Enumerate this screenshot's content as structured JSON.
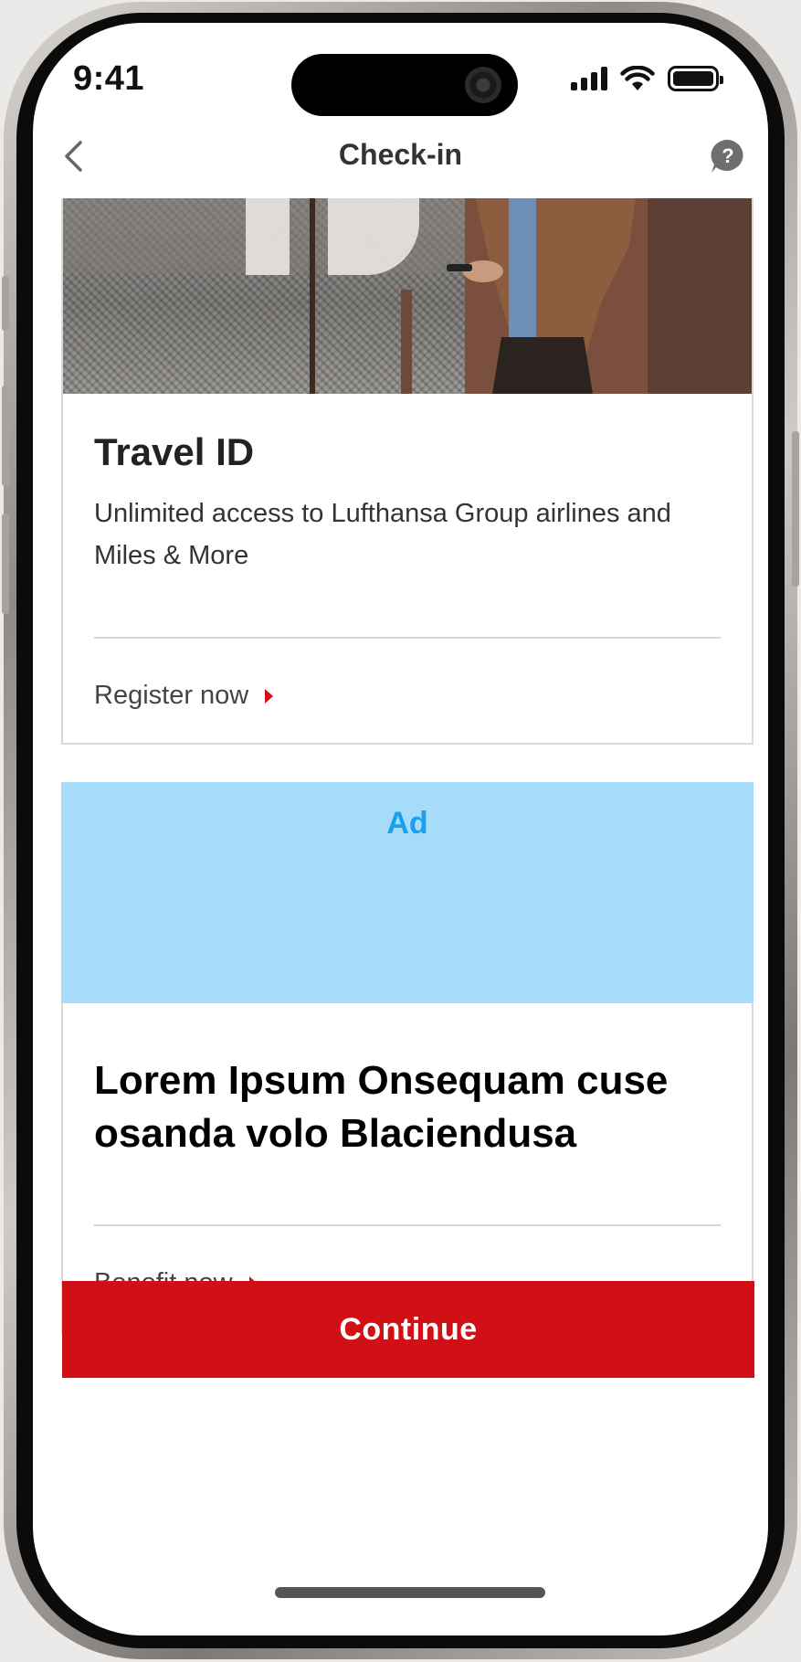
{
  "status_bar": {
    "time": "9:41"
  },
  "nav": {
    "title": "Check-in",
    "back_icon": "chevron-left-icon",
    "help_icon": "question-bubble-icon",
    "help_glyph": "?"
  },
  "hero_image": {
    "lettering": "ID"
  },
  "travel_card": {
    "title": "Travel ID",
    "description": "Unlimited access to Lufthansa Group airlines and Miles & More",
    "link_label": "Register now"
  },
  "ad_card": {
    "ad_label": "Ad",
    "title": "Lorem Ipsum Onsequam cuse osanda volo Blaciendusa",
    "link_label": "Benefit now"
  },
  "footer": {
    "continue_label": "Continue"
  },
  "colors": {
    "brand_red": "#d11015",
    "ad_background": "#a6dcfa",
    "ad_label": "#1aa0ec"
  }
}
